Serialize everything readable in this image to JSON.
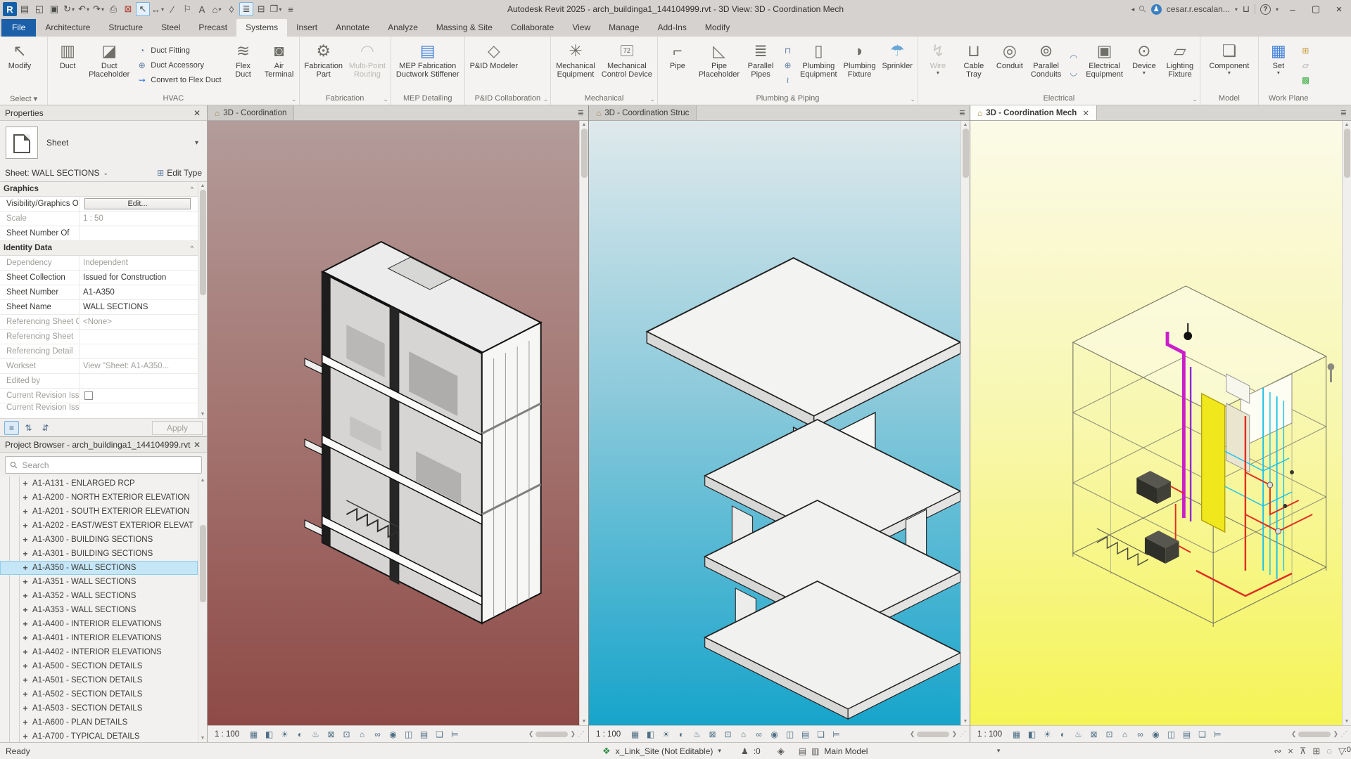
{
  "window": {
    "title": "Autodesk Revit 2025 - arch_buildinga1_144104999.rvt - 3D View: 3D - Coordination Mech",
    "user": "cesar.r.escalan...",
    "minimize": "–",
    "restore": "▢",
    "close": "×"
  },
  "qat": [
    {
      "name": "revit-logo",
      "glyph": "R",
      "logo": true
    },
    {
      "name": "file-properties",
      "glyph": "▤"
    },
    {
      "name": "open",
      "glyph": "◱"
    },
    {
      "name": "save",
      "glyph": "▣"
    },
    {
      "name": "synchronize",
      "glyph": "↻",
      "dd": true
    },
    {
      "name": "undo",
      "glyph": "↶",
      "dd": true
    },
    {
      "name": "redo",
      "glyph": "↷",
      "dd": true
    },
    {
      "name": "print",
      "glyph": "⎙"
    },
    {
      "name": "close-hidden-windows",
      "glyph": "⊠",
      "red": true
    },
    {
      "name": "modify-tool",
      "glyph": "↖",
      "boxed": true
    },
    {
      "name": "measure",
      "glyph": "↔",
      "dd": true
    },
    {
      "name": "aligned-dimension",
      "glyph": "∕"
    },
    {
      "name": "tag-by-category",
      "glyph": "⚐"
    },
    {
      "name": "text",
      "glyph": "A"
    },
    {
      "name": "default-3d-view",
      "glyph": "⌂",
      "dd": true
    },
    {
      "name": "section",
      "glyph": "◊"
    },
    {
      "name": "thin-lines",
      "glyph": "≣",
      "boxed": true
    },
    {
      "name": "close-inactive-views",
      "glyph": "⊟"
    },
    {
      "name": "switch-windows",
      "glyph": "❒",
      "dd": true
    },
    {
      "name": "customize-qat",
      "glyph": "≡"
    }
  ],
  "tabs": {
    "items": [
      {
        "label": "File",
        "file": true
      },
      {
        "label": "Architecture"
      },
      {
        "label": "Structure"
      },
      {
        "label": "Steel"
      },
      {
        "label": "Precast"
      },
      {
        "label": "Systems",
        "active": true
      },
      {
        "label": "Insert"
      },
      {
        "label": "Annotate"
      },
      {
        "label": "Analyze"
      },
      {
        "label": "Massing & Site"
      },
      {
        "label": "Collaborate"
      },
      {
        "label": "View"
      },
      {
        "label": "Manage"
      },
      {
        "label": "Add-Ins"
      },
      {
        "label": "Modify"
      }
    ]
  },
  "ribbon": {
    "panels": {
      "select": "Select ▾",
      "hvac": "HVAC",
      "fabrication": "Fabrication",
      "mep_detailing": "MEP Detailing",
      "pid": "P&ID Collaboration",
      "mechanical": "Mechanical",
      "plumbing": "Plumbing & Piping",
      "electrical": "Electrical",
      "model": "Model",
      "work_plane": "Work Plane"
    },
    "buttons": {
      "modify": "Modify",
      "duct": "Duct",
      "duct_ph1": "Duct",
      "duct_ph2": "Placeholder",
      "duct_fitting": "Duct  Fitting",
      "duct_accessory": "Duct  Accessory",
      "convert_flex": "Convert to  Flex Duct",
      "flex1": "Flex",
      "flex2": "Duct",
      "air1": "Air",
      "air2": "Terminal",
      "fab1": "Fabrication",
      "fab2": "Part",
      "mpr1": "Multi-Point",
      "mpr2": "Routing",
      "stif1": "MEP Fabrication",
      "stif2": "Ductwork Stiffener",
      "pid_modeler": "P&ID Modeler",
      "mecheq1": "Mechanical",
      "mecheq2": "Equipment",
      "mechcd1": "Mechanical",
      "mechcd2": "Control Device",
      "pipe": "Pipe",
      "pipe_ph1": "Pipe",
      "pipe_ph2": "Placeholder",
      "par_pipes1": "Parallel",
      "par_pipes2": "Pipes",
      "plumbeq1": "Plumbing",
      "plumbeq2": "Equipment",
      "plumbfx1": "Plumbing",
      "plumbfx2": "Fixture",
      "sprinkler": "Sprinkler",
      "wire": "Wire",
      "cable1": "Cable",
      "cable2": "Tray",
      "conduit": "Conduit",
      "par_cond1": "Parallel",
      "par_cond2": "Conduits",
      "eleq1": "Electrical",
      "eleq2": "Equipment",
      "device": "Device",
      "light1": "Lighting",
      "light2": "Fixture",
      "component": "Component",
      "set": "Set"
    },
    "icons": {
      "modify": "↖",
      "duct": "▥",
      "duct_placeholder": "◪",
      "duct_fitting": "◔",
      "duct_accessory": "⊕",
      "convert_flex": "⇝",
      "flex_duct": "≋",
      "air_terminal": "◙",
      "fabrication_part": "⚙",
      "multi_point": "◠",
      "mep_stiffener": "▤",
      "pid_modeler": "◇",
      "mech_equipment": "✳",
      "mech_thermo": "72",
      "pipe": "⌐",
      "pipe_placeholder": "◺",
      "parallel_pipes": "≣",
      "pipe_fitting": "⊓",
      "pipe_accessory": "⊕",
      "flex_pipe": "≀",
      "plumbing_equipment": "▯",
      "plumbing_fixture": "◗",
      "sprinkler": "☂",
      "wire": "↯",
      "cable_tray": "⊔",
      "conduit": "◎",
      "parallel_conduits": "⊚",
      "electrical_equipment": "▣",
      "device": "⊙",
      "lighting_fixture": "▱",
      "component": "❏",
      "set": "▦",
      "workplane_show": "⊞",
      "workplane_ref": "▱",
      "workplane_viewer": "▩"
    }
  },
  "properties": {
    "title": "Properties",
    "close": "✕",
    "type_label": "Sheet",
    "instance": "Sheet: WALL SECTIONS",
    "edit_type": "Edit Type",
    "sections": {
      "graphics": "Graphics",
      "identity": "Identity Data"
    },
    "rows": {
      "vg_label": "Visibility/Graphics O...",
      "vg_button": "Edit...",
      "scale_label": "Scale",
      "scale_value": "1 : 50",
      "sheet_number_of": "Sheet Number Of",
      "dependency_label": "Dependency",
      "dependency_value": "Independent",
      "collection_label": "Sheet Collection",
      "collection_value": "Issued for Construction",
      "number_label": "Sheet Number",
      "number_value": "A1-A350",
      "name_label": "Sheet Name",
      "name_value": "WALL SECTIONS",
      "ref_sheet_c_label": "Referencing Sheet C...",
      "ref_sheet_c_value": "<None>",
      "ref_sheet_label": "Referencing Sheet",
      "ref_detail_label": "Referencing Detail",
      "workset_label": "Workset",
      "workset_value": "View \"Sheet: A1-A350...",
      "edited_by_label": "Edited by",
      "rev_issued_label": "Current Revision Issu...",
      "rev_issued2_label": "Current Revision Issu"
    },
    "apply": "Apply"
  },
  "browser": {
    "title": "Project Browser - arch_buildinga1_144104999.rvt",
    "close": "✕",
    "search_placeholder": "Search",
    "items": [
      {
        "label": "A1-A131 - ENLARGED RCP"
      },
      {
        "label": "A1-A200 - NORTH EXTERIOR ELEVATION"
      },
      {
        "label": "A1-A201 - SOUTH EXTERIOR ELEVATION"
      },
      {
        "label": "A1-A202 - EAST/WEST EXTERIOR ELEVAT"
      },
      {
        "label": "A1-A300 - BUILDING SECTIONS"
      },
      {
        "label": "A1-A301 - BUILDING SECTIONS"
      },
      {
        "label": "A1-A350 - WALL SECTIONS",
        "selected": true
      },
      {
        "label": "A1-A351 - WALL SECTIONS"
      },
      {
        "label": "A1-A352 - WALL SECTIONS"
      },
      {
        "label": "A1-A353 - WALL SECTIONS"
      },
      {
        "label": "A1-A400 - INTERIOR ELEVATIONS"
      },
      {
        "label": "A1-A401 - INTERIOR ELEVATIONS"
      },
      {
        "label": "A1-A402 - INTERIOR ELEVATIONS"
      },
      {
        "label": "A1-A500 - SECTION DETAILS"
      },
      {
        "label": "A1-A501 - SECTION DETAILS"
      },
      {
        "label": "A1-A502 - SECTION DETAILS"
      },
      {
        "label": "A1-A503 - SECTION DETAILS"
      },
      {
        "label": "A1-A600 - PLAN DETAILS"
      },
      {
        "label": "A1-A700 - TYPICAL DETAILS"
      }
    ]
  },
  "viewports": [
    {
      "tab": "3D - Coordination",
      "scale": "1 : 100"
    },
    {
      "tab": "3D - Coordination Struc",
      "scale": "1 : 100"
    },
    {
      "tab": "3D - Coordination Mech",
      "scale": "1 : 100",
      "active": true,
      "close": "✕"
    }
  ],
  "view_controls": [
    {
      "name": "detail-level-icon",
      "glyph": "▦"
    },
    {
      "name": "visual-style-icon",
      "glyph": "◧"
    },
    {
      "name": "sun-path-icon",
      "glyph": "☀"
    },
    {
      "name": "shadows-icon",
      "glyph": "◐"
    },
    {
      "name": "rendering-icon",
      "glyph": "♨"
    },
    {
      "name": "crop-view-icon",
      "glyph": "⊠"
    },
    {
      "name": "crop-region-icon",
      "glyph": "⊡"
    },
    {
      "name": "locked-view-icon",
      "glyph": "⌂"
    },
    {
      "name": "hide-isolate-icon",
      "glyph": "∞"
    },
    {
      "name": "reveal-hidden-icon",
      "glyph": "◉"
    },
    {
      "name": "worksharing-display-icon",
      "glyph": "◫"
    },
    {
      "name": "temporary-view-properties-icon",
      "glyph": "▤"
    },
    {
      "name": "displacement-icon",
      "glyph": "❏"
    },
    {
      "name": "reveal-constraints-icon",
      "glyph": "⊨"
    }
  ],
  "status": {
    "ready": "Ready",
    "workset_value": "x_Link_Site (Not Editable)",
    "requests": ":0",
    "model_value": "Main Model",
    "filter_count": ":0"
  },
  "status_icons": [
    {
      "name": "select-links-toggle",
      "glyph": "∾"
    },
    {
      "name": "select-underlay-toggle",
      "glyph": "×"
    },
    {
      "name": "select-pinned-toggle",
      "glyph": "⊼"
    },
    {
      "name": "select-by-face-toggle",
      "glyph": "⊞"
    },
    {
      "name": "drag-on-selection-toggle",
      "glyph": "◌"
    },
    {
      "name": "filter-icon",
      "glyph": "▽"
    }
  ]
}
